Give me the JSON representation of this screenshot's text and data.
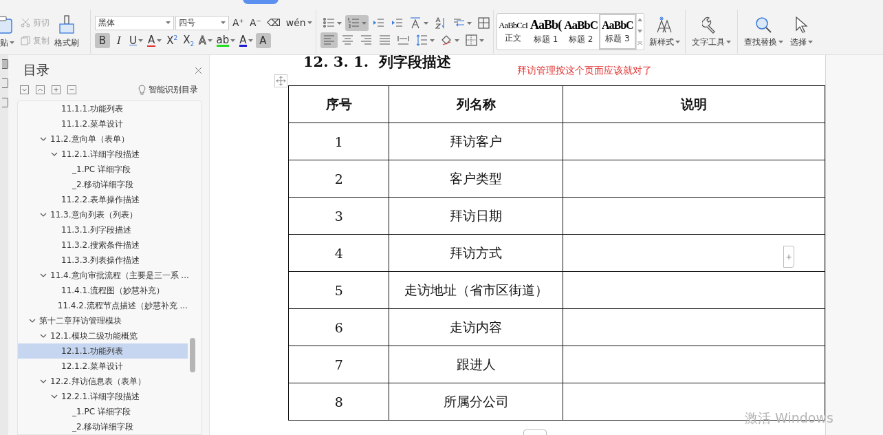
{
  "ribbon": {
    "clipboard": [
      {
        "kind": "paste",
        "label": "贴"
      },
      {
        "kind": "cut",
        "label": "剪切",
        "disabled": true
      },
      {
        "kind": "copy",
        "label": "复制",
        "disabled": true
      },
      {
        "kind": "painter",
        "label": "格式刷"
      }
    ],
    "font": {
      "name": "黑体",
      "size": "四号"
    },
    "font_tools": [
      "A⁺",
      "A⁻",
      "⌫",
      "wén"
    ],
    "format_buttons": [
      {
        "glyph": "B",
        "pressed": true
      },
      {
        "glyph": "I",
        "pressed": false
      },
      {
        "glyph": "U",
        "pressed": false
      },
      {
        "glyph": "A",
        "pressed": false
      },
      {
        "glyph": "X$^{2}$",
        "pressed": false
      },
      {
        "glyph": "X$_{2}$",
        "pressed": false
      },
      {
        "glyph": "A",
        "pressed": false
      },
      {
        "glyph": "ab",
        "pressed": false
      },
      {
        "glyph": "A",
        "pressed": false
      },
      {
        "glyph": "A",
        "pressed": true
      }
    ],
    "paragraph_row1": [
      {
        "kind": "bullets",
        "pressed": false
      },
      {
        "kind": "numbering",
        "pressed": true
      },
      {
        "kind": "outdent",
        "pressed": false
      },
      {
        "kind": "indent",
        "pressed": false
      },
      {
        "kind": "textdir",
        "pressed": false
      },
      {
        "kind": "sort",
        "pressed": false
      },
      {
        "kind": "spacing",
        "pressed": false
      },
      {
        "kind": "table",
        "pressed": false
      }
    ],
    "paragraph_row2": [
      {
        "kind": "align-left",
        "pressed": true
      },
      {
        "kind": "align-center",
        "pressed": false
      },
      {
        "kind": "align-right",
        "pressed": false
      },
      {
        "kind": "justify",
        "pressed": false
      },
      {
        "kind": "distribute",
        "pressed": false
      },
      {
        "kind": "linespacing",
        "pressed": false
      },
      {
        "kind": "shading",
        "pressed": false
      },
      {
        "kind": "borders",
        "pressed": false
      }
    ],
    "styles": [
      {
        "sample": "AaBbCcI",
        "label": "正文",
        "selected": false
      },
      {
        "sample": "AaBb(",
        "label": "标题 1",
        "selected": false
      },
      {
        "sample": "AaBbC",
        "label": "标题 2",
        "selected": false
      },
      {
        "sample": "AaBbC",
        "label": "标题 3",
        "selected": true
      }
    ],
    "tools": [
      {
        "kind": "newstyle",
        "label": "新样式"
      },
      {
        "kind": "texttools",
        "label": "文字工具"
      },
      {
        "kind": "find",
        "label": "查找替换"
      },
      {
        "kind": "select",
        "label": "选择"
      }
    ]
  },
  "toc": {
    "title": "目录",
    "smart_button": "智能识别目录",
    "items": [
      {
        "children": [
          {
            "children": [
              {
                "label": "11.1.1.功能列表",
                "selected": false
              },
              {
                "label": "11.1.2.菜单设计",
                "selected": false
              }
            ]
          },
          {
            "label": "11.2.意向单（表单）",
            "selected": false,
            "expanded": true,
            "children": [
              {
                "label": "11.2.1.详细字段描述",
                "selected": false,
                "expanded": true,
                "children": [
                  {
                    "label": "_1.PC 详细字段",
                    "selected": false
                  },
                  {
                    "label": "_2.移动详细字段",
                    "selected": false
                  }
                ]
              },
              {
                "label": "11.2.2.表单操作描述",
                "selected": false
              }
            ]
          },
          {
            "label": "11.3.意向列表（列表）",
            "selected": false,
            "expanded": true,
            "children": [
              {
                "label": "11.3.1.列字段描述",
                "selected": false
              },
              {
                "label": "11.3.2.搜索条件描述",
                "selected": false
              },
              {
                "label": "11.3.3.列表操作描述",
                "selected": false
              }
            ]
          },
          {
            "label": "11.4.意向审批流程（主要是三一系 ...",
            "selected": false,
            "expanded": true,
            "children": [
              {
                "label": "11.4.1.流程图（妙慧补充）",
                "selected": false
              },
              {
                "label": "11.4.2.流程节点描述（妙慧补充 ...",
                "selected": false
              }
            ]
          }
        ]
      },
      {
        "label": "第十二章拜访管理模块",
        "selected": false,
        "expanded": true,
        "children": [
          {
            "label": "12.1.模块二级功能概览",
            "selected": false,
            "expanded": true,
            "children": [
              {
                "label": "12.1.1.功能列表",
                "selected": true
              },
              {
                "label": "12.1.2.菜单设计",
                "selected": false
              }
            ]
          },
          {
            "label": "12.2.拜访信息表（表单）",
            "selected": false,
            "expanded": true,
            "children": [
              {
                "label": "12.2.1.详细字段描述",
                "selected": false,
                "expanded": true,
                "children": [
                  {
                    "label": "_1.PC 详细字段",
                    "selected": false
                  },
                  {
                    "label": "_2.移动详细字段",
                    "selected": false
                  }
                ]
              }
            ]
          }
        ]
      }
    ]
  },
  "document": {
    "heading": "12. 3. 1.  列字段描述",
    "comment": "拜访管理按这个页面应该就对了",
    "table": {
      "columns": [
        "序号",
        "列名称",
        "说明"
      ],
      "rows": [
        {
          "no": "1",
          "name": "拜访客户"
        },
        {
          "no": "2",
          "name": "客户类型"
        },
        {
          "no": "3",
          "name": "拜访日期"
        },
        {
          "no": "4",
          "name": "拜访方式"
        },
        {
          "no": "5",
          "name": "走访地址（省市区街道）"
        },
        {
          "no": "6",
          "name": "走访内容"
        },
        {
          "no": "7",
          "name": "跟进人"
        },
        {
          "no": "8",
          "name": "所属分公司"
        }
      ]
    },
    "add_handle": "+"
  },
  "watermark": "激活 Windows"
}
